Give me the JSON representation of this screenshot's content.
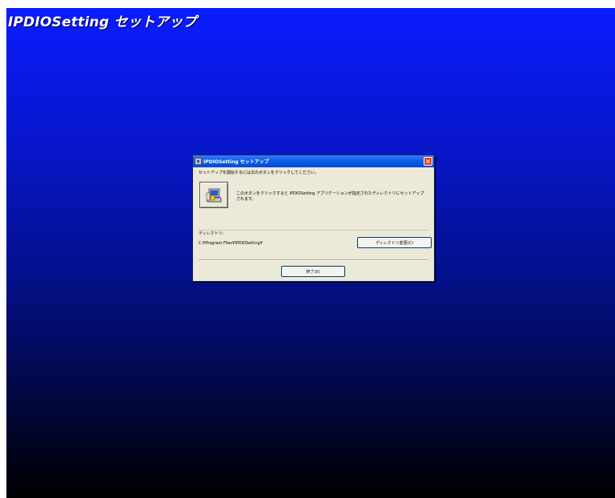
{
  "banner": {
    "title": "IPDIOSetting セットアップ"
  },
  "dialog": {
    "title": "IPDIOSetting セットアップ",
    "close_label": "×",
    "instruction": "セットアップを開始するには次のボタンをクリックしてください。",
    "description": "このボタンをクリックすると IPDIOSetting アプリケーションが指定されたディレクトリにセットアップされます。",
    "directory_label": "ディレクトリ:",
    "directory_path": "C:¥Program Files¥IPDIOSetting¥",
    "change_dir_label": "ディレクトリ変更(C)",
    "exit_label": "終了(X)"
  },
  "colors": {
    "desktop_top": "#0b1cff",
    "desktop_bottom": "#000000",
    "dialog_bg": "#ece9d8",
    "titlebar": "#0a5fe8"
  }
}
